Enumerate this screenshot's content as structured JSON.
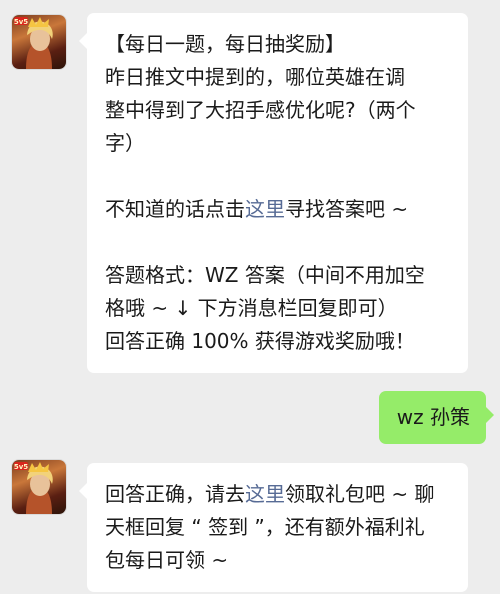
{
  "messages": [
    {
      "sender": "game-account",
      "lines": [
        [
          "【每日一题，每日抽奖励】"
        ],
        [
          "昨日推文中提到的，哪位英雄在调"
        ],
        [
          "整中得到了大招手感优化呢?（两个"
        ],
        [
          "字）"
        ],
        [],
        [
          "不知道的话点击",
          "这里",
          "寻找答案吧 ~"
        ],
        [],
        [
          "答题格式：WZ 答案（中间不用加空"
        ],
        [
          "格哦 ~ ↓ 下方消息栏回复即可）"
        ],
        [
          "回答正确 100% 获得游戏奖励哦！"
        ]
      ]
    },
    {
      "sender": "user",
      "text": "wz 孙策"
    },
    {
      "sender": "game-account",
      "lines": [
        [
          "回答正确，请去",
          "这里",
          "领取礼包吧 ~ 聊"
        ],
        [
          "天框回复 “ 签到 ”，还有额外福利礼"
        ],
        [
          "包每日可领 ~"
        ]
      ]
    }
  ],
  "avatar_badge": "5v5",
  "colors": {
    "background": "#ededed",
    "bubble_received": "#ffffff",
    "bubble_sent": "#95ec69",
    "link": "#576b95"
  }
}
